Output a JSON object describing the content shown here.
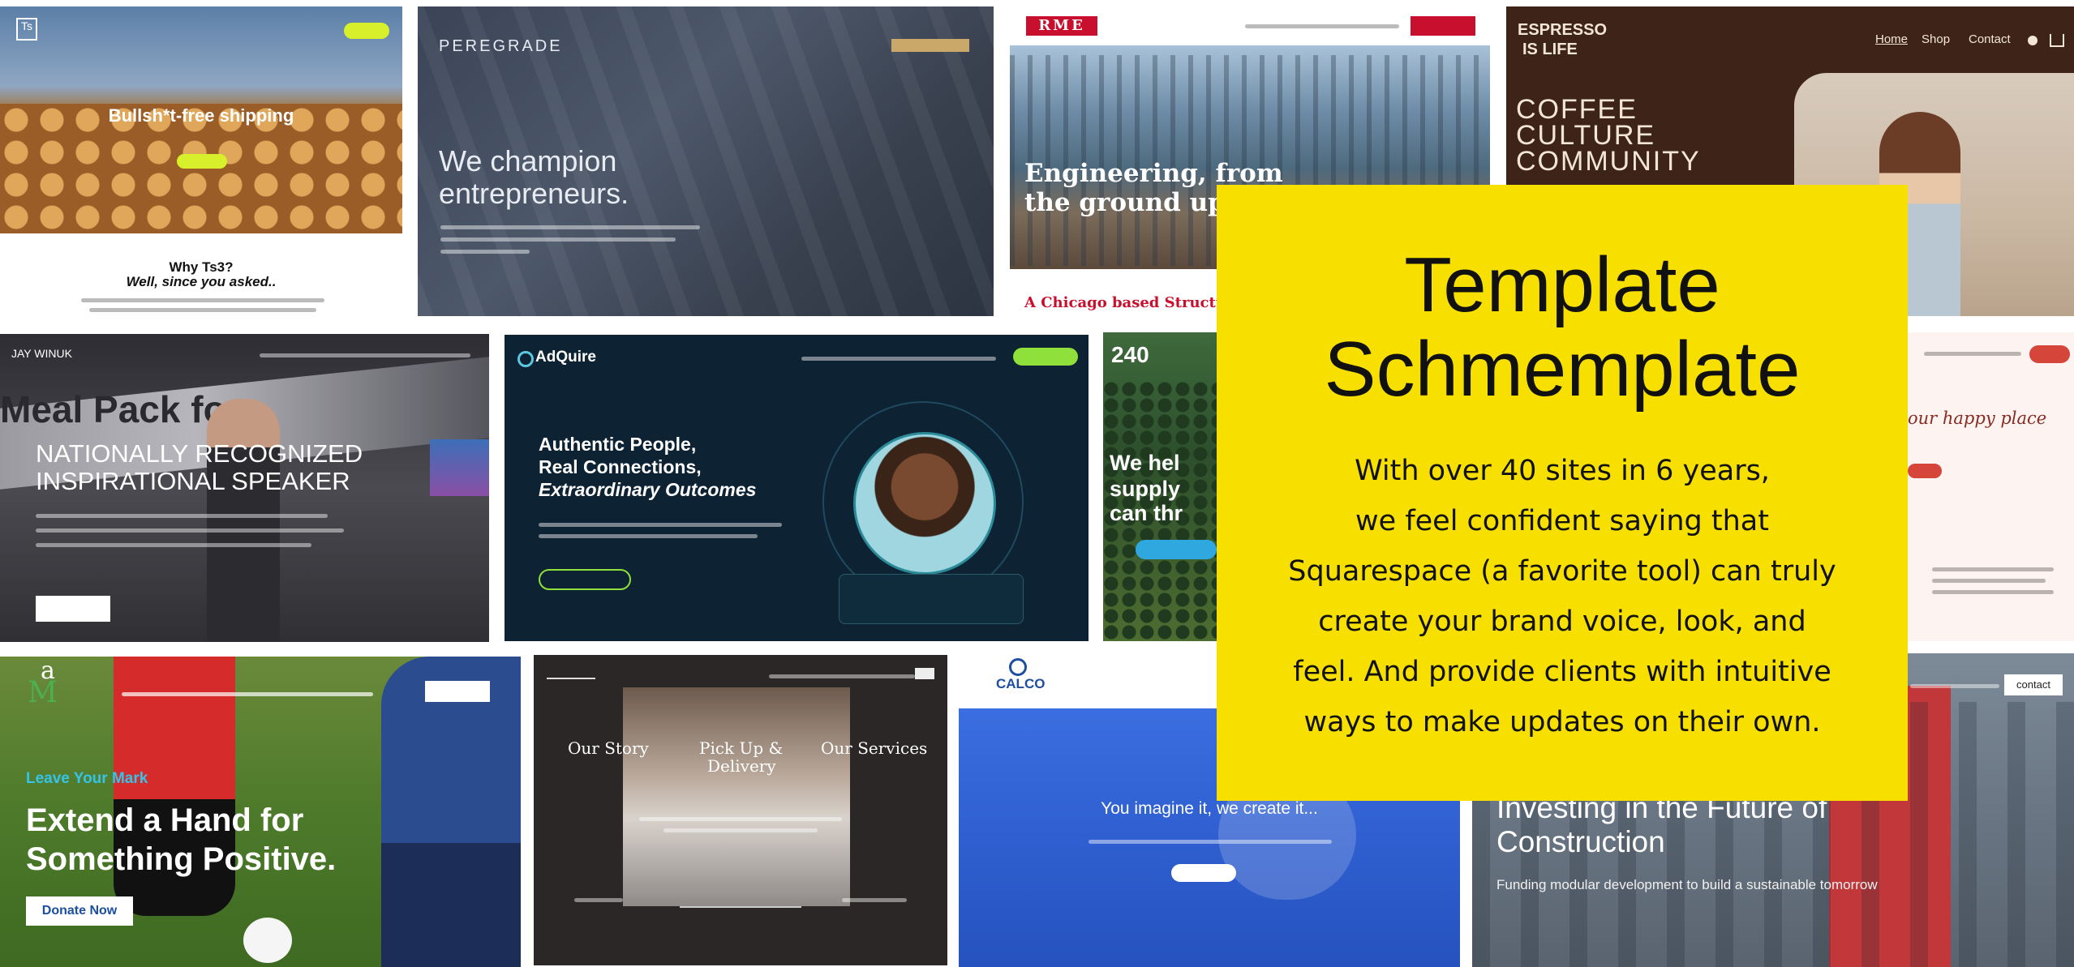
{
  "feature": {
    "title_line1": "Template",
    "title_line2": "Schmemplate",
    "body_lines": [
      "With over 40 sites in 6 years,",
      "we feel confident saying that",
      "Squarespace (a favorite tool) can truly",
      "create your brand voice, look, and",
      "feel. And provide clients with intuitive",
      "ways to make updates on their own."
    ]
  },
  "tiles": {
    "shipping": {
      "logo": "Ts",
      "headline": "Bullsh*t-free shipping",
      "why_line1": "Why Ts3?",
      "why_line2": "Well, since you asked.."
    },
    "peregrade": {
      "brand": "PEREGRADE",
      "headline_line1": "We champion",
      "headline_line2": "entrepreneurs."
    },
    "rme": {
      "logo": "RME",
      "headline_line1": "Engineering, from",
      "headline_line2": "the ground up",
      "footer": "A Chicago based Structur"
    },
    "espresso": {
      "logo_line1": "ESPRESSO",
      "logo_line2": "IS LIFE",
      "nav": [
        "Home",
        "Shop",
        "Contact"
      ],
      "headline_line1": "COFFEE",
      "headline_line2": "CULTURE",
      "headline_line3": "COMMUNITY"
    },
    "speaker": {
      "brand": "JAY WINUK",
      "banner_text": "Meal Pack fo",
      "headline_line1": "NATIONALLY RECOGNIZED",
      "headline_line2": "INSPIRATIONAL SPEAKER"
    },
    "adquire": {
      "brand": "AdQuire",
      "headline_line1": "Authentic People,",
      "headline_line2": "Real Connections,",
      "headline_line3": "Extraordinary Outcomes"
    },
    "supply": {
      "badge": "240",
      "headline_line1": "We hel",
      "headline_line2": "supply",
      "headline_line3": "can thr"
    },
    "happy": {
      "headline": "our happy place"
    },
    "soccer": {
      "logo_top": "a",
      "logo_bottom": "M",
      "eyebrow": "Leave Your Mark",
      "headline_line1": "Extend a Hand for",
      "headline_line2": "Something Positive.",
      "cta": "Donate Now"
    },
    "andrew": {
      "nav_items": [
        "Our Story",
        "Pick Up &",
        "Delivery",
        "Our Services"
      ]
    },
    "calco": {
      "logo": "CALCO",
      "headline": "You imagine it, we create it..."
    },
    "construction": {
      "contact": "contact",
      "headline_line1": "Investing in the Future of",
      "headline_line2": "Construction",
      "subtext": "Funding modular development to build a sustainable tomorrow"
    }
  },
  "colors": {
    "feature_bg": "#f7e000",
    "lime": "#d8ef2c",
    "rme_red": "#c8102e",
    "espresso_brown": "#3e2418",
    "adquire_navy": "#0d2233"
  }
}
